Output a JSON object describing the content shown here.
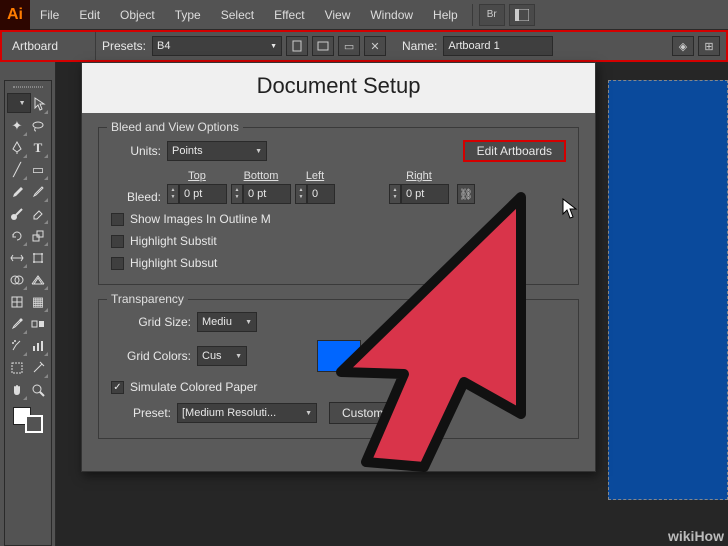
{
  "app": {
    "logo": "Ai"
  },
  "menu": [
    "File",
    "Edit",
    "Object",
    "Type",
    "Select",
    "Effect",
    "View",
    "Window",
    "Help"
  ],
  "menubar_icons": [
    "Br",
    "layout"
  ],
  "controlbar": {
    "tool_label": "Artboard",
    "presets_label": "Presets:",
    "presets_value": "B4",
    "name_label": "Name:",
    "name_value": "Artboard 1"
  },
  "dialog": {
    "title": "Document Setup",
    "bleed_view": {
      "legend": "Bleed and View Options",
      "units_label": "Units:",
      "units_value": "Points",
      "edit_artboards": "Edit Artboards",
      "bleed_label": "Bleed:",
      "cols": [
        "Top",
        "Bottom",
        "Left",
        "Right"
      ],
      "vals": [
        "0 pt",
        "0 pt",
        "0",
        "0 pt"
      ],
      "chk_outline": "Show Images In Outline M",
      "chk_sub1": "Highlight Substit",
      "chk_sub2": "Highlight Subsut"
    },
    "transparency": {
      "legend": "Transparency",
      "grid_size_label": "Grid Size:",
      "grid_size_value": "Mediu",
      "grid_colors_label": "Grid Colors:",
      "grid_colors_value": "Cus",
      "simulate_label": "Simulate Colored Paper",
      "preset_label": "Preset:",
      "preset_value": "[Medium Resoluti...",
      "custom_btn": "Custom..."
    }
  },
  "colors": {
    "swatch1": "#0066ff",
    "swatch2": "#0066ff",
    "artboard_bg": "#0a4a9c",
    "highlight_red": "#d40000"
  },
  "watermark": "wikiHow"
}
